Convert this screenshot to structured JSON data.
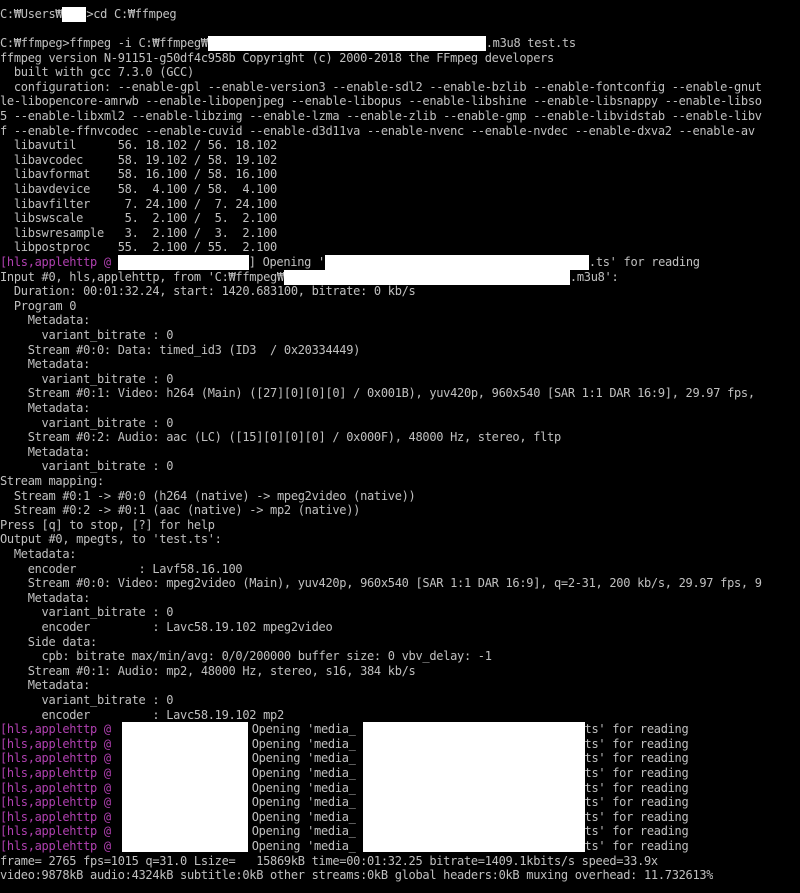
{
  "window": {
    "type": "windows-command-prompt"
  },
  "colors": {
    "background": "#000000",
    "text": "#c0c0c0",
    "hls_prefix": "#b040b0",
    "redaction": "#ffffff"
  },
  "terminal": {
    "lines": [
      {
        "id": 0,
        "text": "C:₩Users₩"
      },
      {
        "id": 1,
        "text": ">cd C:₩ffmpeg"
      },
      {
        "id": 2,
        "text": "C:₩ffmpeg>ffmpeg -i C:₩ffmpeg₩"
      },
      {
        "id": 3,
        "text": ".m3u8 test.ts"
      },
      {
        "id": 4,
        "text": "ffmpeg version N-91151-g50df4c958b Copyright (c) 2000-2018 the FFmpeg developers"
      },
      {
        "id": 5,
        "text": "  built with gcc 7.3.0 (GCC)"
      },
      {
        "id": 6,
        "text": "  configuration: --enable-gpl --enable-version3 --enable-sdl2 --enable-bzlib --enable-fontconfig --enable-gnut"
      },
      {
        "id": 7,
        "text": "le-libopencore-amrwb --enable-libopenjpeg --enable-libopus --enable-libshine --enable-libsnappy --enable-libso"
      },
      {
        "id": 8,
        "text": "5 --enable-libxml2 --enable-libzimg --enable-lzma --enable-zlib --enable-gmp --enable-libvidstab --enable-libv"
      },
      {
        "id": 9,
        "text": "f --enable-ffnvcodec --enable-cuvid --enable-d3d11va --enable-nvenc --enable-nvdec --enable-dxva2 --enable-av"
      },
      {
        "id": 10,
        "text": "  libavutil      56. 18.102 / 56. 18.102"
      },
      {
        "id": 11,
        "text": "  libavcodec     58. 19.102 / 58. 19.102"
      },
      {
        "id": 12,
        "text": "  libavformat    58. 16.100 / 58. 16.100"
      },
      {
        "id": 13,
        "text": "  libavdevice    58.  4.100 / 58.  4.100"
      },
      {
        "id": 14,
        "text": "  libavfilter     7. 24.100 /  7. 24.100"
      },
      {
        "id": 15,
        "text": "  libswscale      5.  2.100 /  5.  2.100"
      },
      {
        "id": 16,
        "text": "  libswresample   3.  2.100 /  3.  2.100"
      },
      {
        "id": 17,
        "text": "  libpostproc    55.  2.100 / 55.  2.100"
      },
      {
        "id": 18,
        "text": "[hls,applehttp @ "
      },
      {
        "id": 19,
        "text": "] Opening '"
      },
      {
        "id": 20,
        "text": ".ts' for reading"
      },
      {
        "id": 21,
        "text": "Input #0, hls,applehttp, from 'C:₩ffmpeg₩"
      },
      {
        "id": 22,
        "text": ".m3u8':"
      },
      {
        "id": 23,
        "text": "  Duration: 00:01:32.24, start: 1420.683100, bitrate: 0 kb/s"
      },
      {
        "id": 24,
        "text": "  Program 0"
      },
      {
        "id": 25,
        "text": "    Metadata:"
      },
      {
        "id": 26,
        "text": "      variant_bitrate : 0"
      },
      {
        "id": 27,
        "text": "    Stream #0:0: Data: timed_id3 (ID3  / 0x20334449)"
      },
      {
        "id": 28,
        "text": "    Metadata:"
      },
      {
        "id": 29,
        "text": "      variant_bitrate : 0"
      },
      {
        "id": 30,
        "text": "    Stream #0:1: Video: h264 (Main) ([27][0][0][0] / 0x001B), yuv420p, 960x540 [SAR 1:1 DAR 16:9], 29.97 fps,"
      },
      {
        "id": 31,
        "text": "    Metadata:"
      },
      {
        "id": 32,
        "text": "      variant_bitrate : 0"
      },
      {
        "id": 33,
        "text": "    Stream #0:2: Audio: aac (LC) ([15][0][0][0] / 0x000F), 48000 Hz, stereo, fltp"
      },
      {
        "id": 34,
        "text": "    Metadata:"
      },
      {
        "id": 35,
        "text": "      variant_bitrate : 0"
      },
      {
        "id": 36,
        "text": "Stream mapping:"
      },
      {
        "id": 37,
        "text": "  Stream #0:1 -> #0:0 (h264 (native) -> mpeg2video (native))"
      },
      {
        "id": 38,
        "text": "  Stream #0:2 -> #0:1 (aac (native) -> mp2 (native))"
      },
      {
        "id": 39,
        "text": "Press [q] to stop, [?] for help"
      },
      {
        "id": 40,
        "text": "Output #0, mpegts, to 'test.ts':"
      },
      {
        "id": 41,
        "text": "  Metadata:"
      },
      {
        "id": 42,
        "text": "    encoder         : Lavf58.16.100"
      },
      {
        "id": 43,
        "text": "    Stream #0:0: Video: mpeg2video (Main), yuv420p, 960x540 [SAR 1:1 DAR 16:9], q=2-31, 200 kb/s, 29.97 fps, 9"
      },
      {
        "id": 44,
        "text": "    Metadata:"
      },
      {
        "id": 45,
        "text": "      variant_bitrate : 0"
      },
      {
        "id": 46,
        "text": "      encoder         : Lavc58.19.102 mpeg2video"
      },
      {
        "id": 47,
        "text": "    Side data:"
      },
      {
        "id": 48,
        "text": "      cpb: bitrate max/min/avg: 0/0/200000 buffer size: 0 vbv_delay: -1"
      },
      {
        "id": 49,
        "text": "    Stream #0:1: Audio: mp2, 48000 Hz, stereo, s16, 384 kb/s"
      },
      {
        "id": 50,
        "text": "    Metadata:"
      },
      {
        "id": 51,
        "text": "      variant_bitrate : 0"
      },
      {
        "id": 52,
        "text": "      encoder         : Lavc58.19.102 mp2"
      },
      {
        "id": 53,
        "text": "[hls,applehttp @ "
      },
      {
        "id": 54,
        "text": "Opening 'media_"
      },
      {
        "id": 55,
        "text": ".ts' for reading"
      },
      {
        "id": 56,
        "text": "frame= 2765 fps=1015 q=31.0 Lsize=   15869kB time=00:01:32.25 bitrate=1409.1kbits/s speed=33.9x"
      },
      {
        "id": 57,
        "text": "video:9878kB audio:4324kB subtitle:0kB other streams:0kB global headers:0kB muxing overhead: 11.732613%"
      }
    ]
  }
}
